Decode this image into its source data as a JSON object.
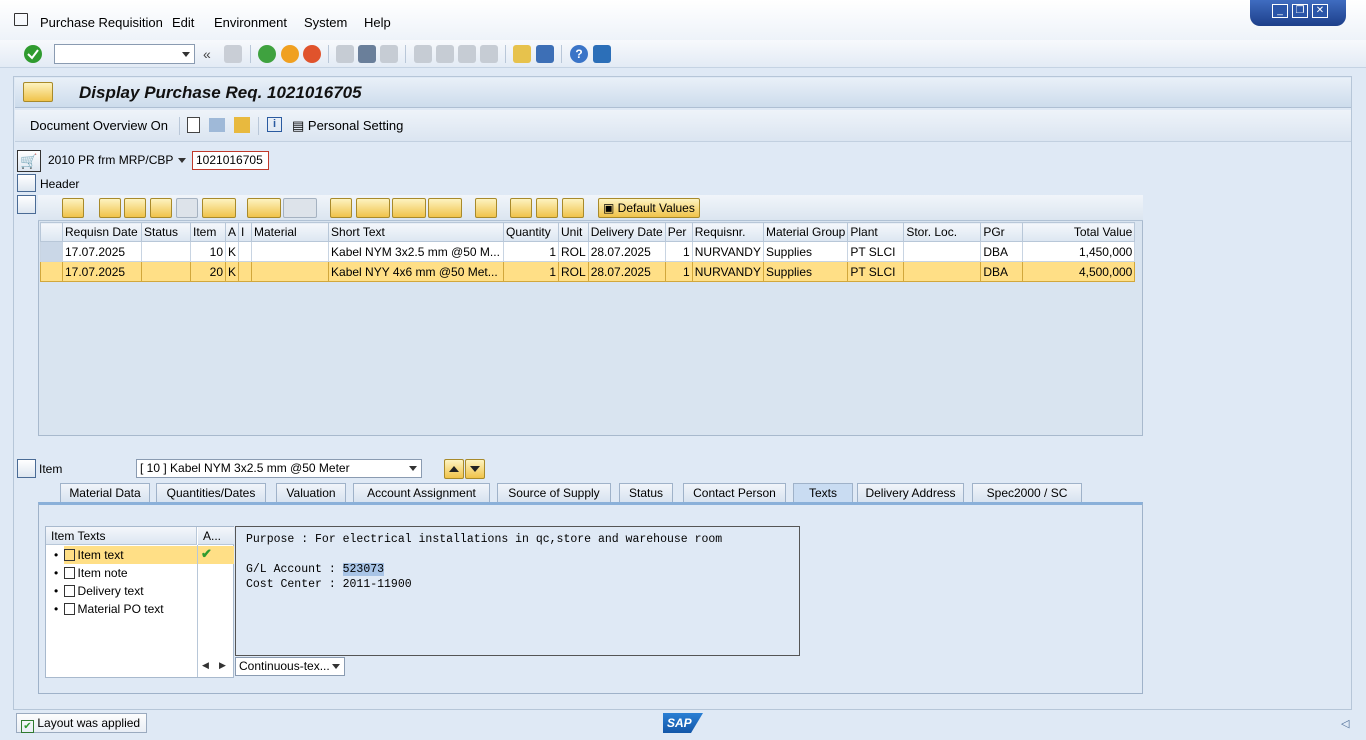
{
  "menu": {
    "items": [
      "Purchase Requisition",
      "Edit",
      "Environment",
      "System",
      "Help"
    ]
  },
  "window_controls": [
    "_",
    "❐",
    "✕"
  ],
  "title": "Display Purchase Req. 1021016705",
  "appbar": {
    "doc_overview": "Document Overview On",
    "personal_setting": "Personal Setting"
  },
  "header_area": {
    "doc_type": "2010 PR frm MRP/CBP",
    "pr_number": "1021016705",
    "header_label": "Header"
  },
  "grid_toolbar": {
    "default_values": "Default Values"
  },
  "grid": {
    "columns": [
      "Requisn Date",
      "Status",
      "Item",
      "A",
      "I",
      "Material",
      "Short Text",
      "Quantity",
      "Unit",
      "Delivery Date",
      "Per",
      "Requisnr.",
      "Material Group",
      "Plant",
      "Stor. Loc.",
      "PGr",
      "Total Value"
    ],
    "rows": [
      [
        "17.07.2025",
        "",
        "10",
        "K",
        "",
        "",
        "Kabel NYM 3x2.5 mm @50 M...",
        "1",
        "ROL",
        "28.07.2025",
        "1",
        "NURVANDY",
        "Supplies",
        "PT SLCI",
        "",
        "DBA",
        "1,450,000"
      ],
      [
        "17.07.2025",
        "",
        "20",
        "K",
        "",
        "",
        "Kabel NYY 4x6 mm @50 Met...",
        "1",
        "ROL",
        "28.07.2025",
        "1",
        "NURVANDY",
        "Supplies",
        "PT SLCI",
        "",
        "DBA",
        "4,500,000"
      ]
    ]
  },
  "item_area": {
    "label": "Item",
    "selected_item": "[ 10 ] Kabel NYM 3x2.5 mm @50 Meter"
  },
  "tabs": [
    "Material Data",
    "Quantities/Dates",
    "Valuation",
    "Account Assignment",
    "Source of Supply",
    "Status",
    "Contact Person",
    "Texts",
    "Delivery Address",
    "Spec2000 / SC"
  ],
  "active_tab": "Texts",
  "texts": {
    "col_item_texts": "Item Texts",
    "col_a": "A...",
    "entries": [
      "Item text",
      "Item note",
      "Delivery text",
      "Material PO text"
    ],
    "editor_line1": "Purpose : For electrical installations in qc,store and warehouse room",
    "editor_gl_label": "G/L Account : ",
    "editor_gl_value": "523073",
    "editor_line3": "Cost Center : 2011-11900",
    "editor_mode": "Continuous-tex..."
  },
  "status": {
    "message": "Layout was applied",
    "logo": "SAP"
  }
}
